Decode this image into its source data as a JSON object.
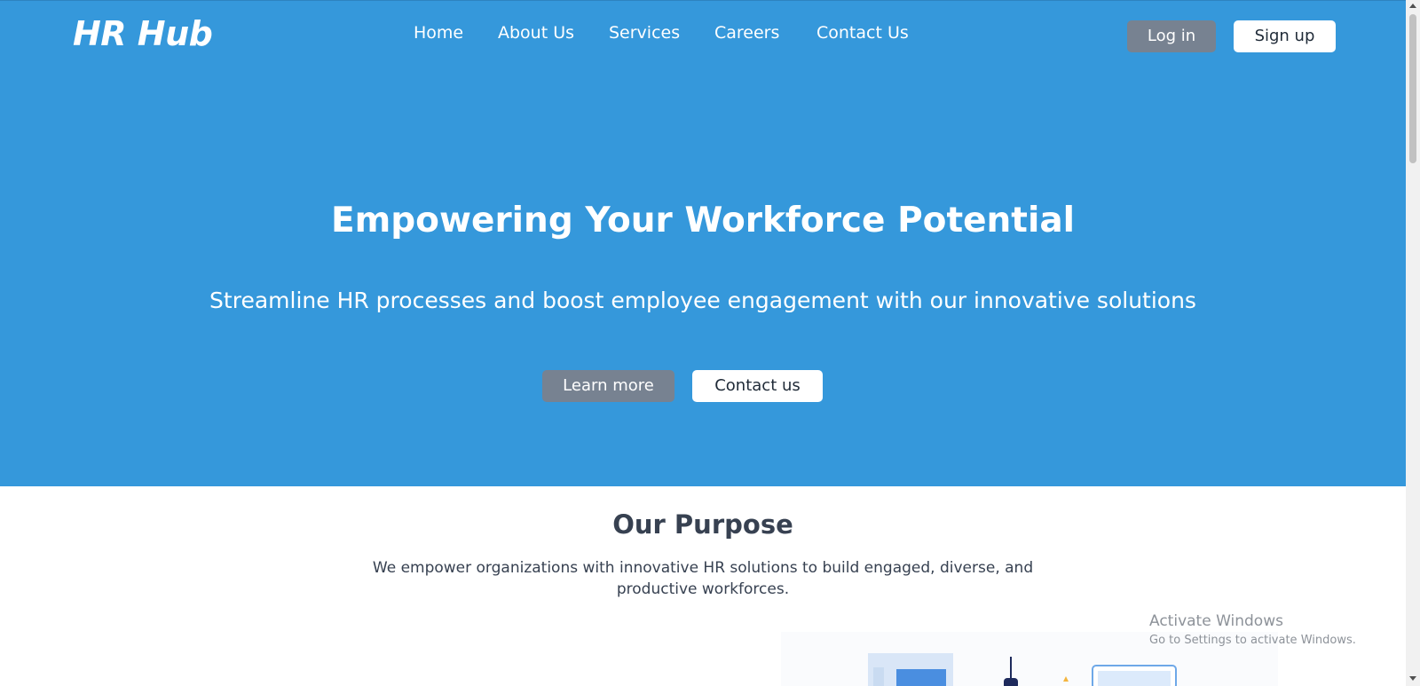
{
  "brand": {
    "logo_text": "HR Hub"
  },
  "nav": {
    "items": [
      {
        "label": "Home"
      },
      {
        "label": "About Us"
      },
      {
        "label": "Services"
      },
      {
        "label": "Careers"
      },
      {
        "label": "Contact Us"
      }
    ]
  },
  "auth": {
    "login_label": "Log in",
    "signup_label": "Sign up"
  },
  "hero": {
    "title": "Empowering Your Workforce Potential",
    "subtitle": "Streamline HR processes and boost employee engagement with our innovative solutions",
    "primary_cta": "Learn more",
    "secondary_cta": "Contact us"
  },
  "purpose": {
    "title": "Our Purpose",
    "text": "We empower organizations with innovative HR solutions to build engaged, diverse, and productive workforces."
  },
  "watermark": {
    "title": "Activate Windows",
    "subtitle": "Go to Settings to activate Windows."
  },
  "colors": {
    "hero_bg": "#3598DB",
    "button_gray": "#778291",
    "button_white": "#FFFFFF",
    "heading_dark": "#374151"
  }
}
